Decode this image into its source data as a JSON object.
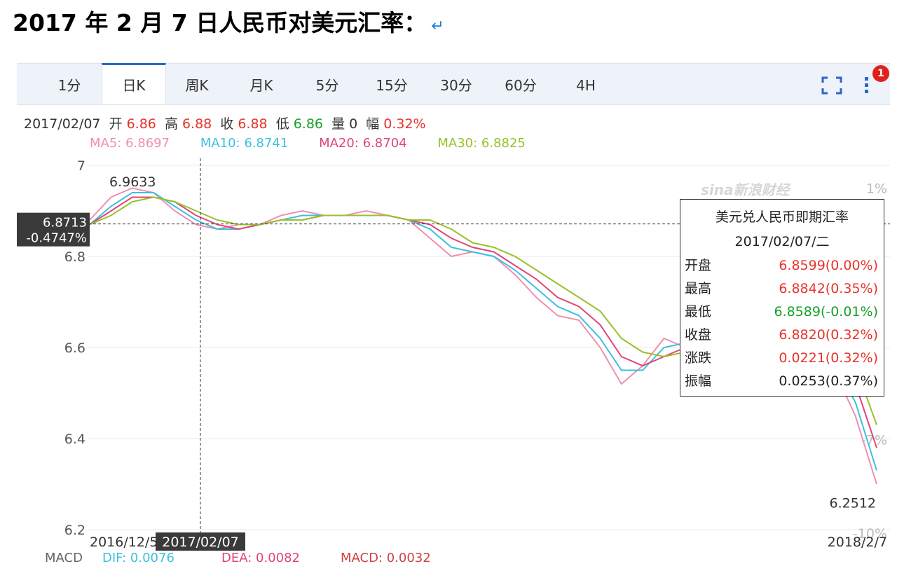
{
  "document": {
    "heading": "2017 年 2 月 7 日人民币对美元汇率：",
    "return_mark": "↵"
  },
  "toolbar": {
    "tabs": [
      {
        "label": "1分",
        "active": false
      },
      {
        "label": "日K",
        "active": true
      },
      {
        "label": "周K",
        "active": false
      },
      {
        "label": "月K",
        "active": false
      },
      {
        "label": "5分",
        "active": false
      },
      {
        "label": "15分",
        "active": false
      },
      {
        "label": "30分",
        "active": false
      },
      {
        "label": "60分",
        "active": false
      },
      {
        "label": "4H",
        "active": false
      }
    ],
    "fullscreen_icon": "expand-corners-icon",
    "more_icon": "vertical-dots-icon",
    "notification_count": "1",
    "accent": "#2a66c8"
  },
  "info": {
    "date": "2017/02/07",
    "open_label": "开",
    "open": "6.86",
    "high_label": "高",
    "high": "6.88",
    "close_label": "收",
    "close": "6.88",
    "low_label": "低",
    "low": "6.86",
    "volume_label": "量",
    "volume": "0",
    "range_label": "幅",
    "range": "0.32%"
  },
  "ma": {
    "ma5": "MA5: 6.8697",
    "ma10": "MA10: 6.8741",
    "ma20": "MA20: 6.8704",
    "ma30": "MA30: 6.8825"
  },
  "watermark": "sina新浪财经",
  "tooltip": {
    "title": "美元兑人民币即期汇率",
    "date": "2017/02/07/二",
    "rows": [
      {
        "label": "开盘",
        "value": "6.8599(0.00%)",
        "color": "#e8332a"
      },
      {
        "label": "最高",
        "value": "6.8842(0.35%)",
        "color": "#e8332a"
      },
      {
        "label": "最低",
        "value": "6.8589(-0.01%)",
        "color": "#18a02a"
      },
      {
        "label": "收盘",
        "value": "6.8820(0.32%)",
        "color": "#e8332a"
      },
      {
        "label": "涨跌",
        "value": "0.0221(0.32%)",
        "color": "#e8332a"
      },
      {
        "label": "振幅",
        "value": "0.0253(0.37%)",
        "color": "#222222"
      }
    ]
  },
  "chart_data": {
    "type": "line",
    "title": "",
    "ylim": [
      6.2,
      7.0
    ],
    "y_ticks": [
      "7",
      "6.8",
      "6.6",
      "6.4",
      "6.2"
    ],
    "y_tick_values": [
      7.0,
      6.8,
      6.6,
      6.4,
      6.2
    ],
    "right_ticks": [
      "1%",
      "-7%",
      "-10%"
    ],
    "right_tick_values": [
      6.95,
      6.398,
      6.192
    ],
    "x_labels": {
      "start": "2016/12/5",
      "end": "2018/2/7"
    },
    "crosshair": {
      "x_label": "2017/02/07",
      "y_label": "6.8713",
      "pct_label": "-0.4747%",
      "y_value": 6.8713
    },
    "annotations": [
      {
        "text": "6.9633",
        "value": 6.9633
      },
      {
        "text": "6.2512",
        "value": 6.2512
      }
    ],
    "series": [
      {
        "name": "MA5",
        "color": "#f08fb0",
        "values": [
          6.88,
          6.93,
          6.95,
          6.94,
          6.9,
          6.87,
          6.86,
          6.87,
          6.87,
          6.89,
          6.9,
          6.89,
          6.89,
          6.9,
          6.89,
          6.88,
          6.84,
          6.8,
          6.81,
          6.8,
          6.76,
          6.71,
          6.67,
          6.66,
          6.6,
          6.52,
          6.56,
          6.62,
          6.6,
          6.61,
          6.62,
          6.63,
          6.62,
          6.63,
          6.6,
          6.55,
          6.45,
          6.3
        ]
      },
      {
        "name": "MA10",
        "color": "#3dbfe0",
        "values": [
          6.87,
          6.91,
          6.94,
          6.94,
          6.91,
          6.88,
          6.86,
          6.86,
          6.87,
          6.88,
          6.89,
          6.89,
          6.89,
          6.89,
          6.89,
          6.88,
          6.86,
          6.82,
          6.81,
          6.8,
          6.77,
          6.73,
          6.69,
          6.67,
          6.62,
          6.55,
          6.55,
          6.6,
          6.61,
          6.6,
          6.61,
          6.62,
          6.62,
          6.62,
          6.6,
          6.56,
          6.48,
          6.33
        ]
      },
      {
        "name": "MA20",
        "color": "#e0457a",
        "values": [
          6.87,
          6.9,
          6.93,
          6.93,
          6.92,
          6.89,
          6.87,
          6.86,
          6.87,
          6.88,
          6.88,
          6.89,
          6.89,
          6.89,
          6.89,
          6.88,
          6.87,
          6.84,
          6.82,
          6.81,
          6.78,
          6.75,
          6.71,
          6.69,
          6.65,
          6.58,
          6.56,
          6.58,
          6.6,
          6.6,
          6.61,
          6.62,
          6.62,
          6.62,
          6.61,
          6.58,
          6.52,
          6.38
        ]
      },
      {
        "name": "MA30",
        "color": "#98c22a",
        "values": [
          6.87,
          6.89,
          6.92,
          6.93,
          6.92,
          6.9,
          6.88,
          6.87,
          6.87,
          6.88,
          6.88,
          6.89,
          6.89,
          6.89,
          6.89,
          6.88,
          6.88,
          6.86,
          6.83,
          6.82,
          6.8,
          6.77,
          6.74,
          6.71,
          6.68,
          6.62,
          6.59,
          6.58,
          6.59,
          6.6,
          6.6,
          6.61,
          6.62,
          6.62,
          6.62,
          6.6,
          6.56,
          6.43
        ]
      }
    ]
  },
  "macd": {
    "label": "MACD",
    "dif": "DIF: 0.0076",
    "dea": "DEA: 0.0082",
    "macd": "MACD: 0.0032"
  }
}
